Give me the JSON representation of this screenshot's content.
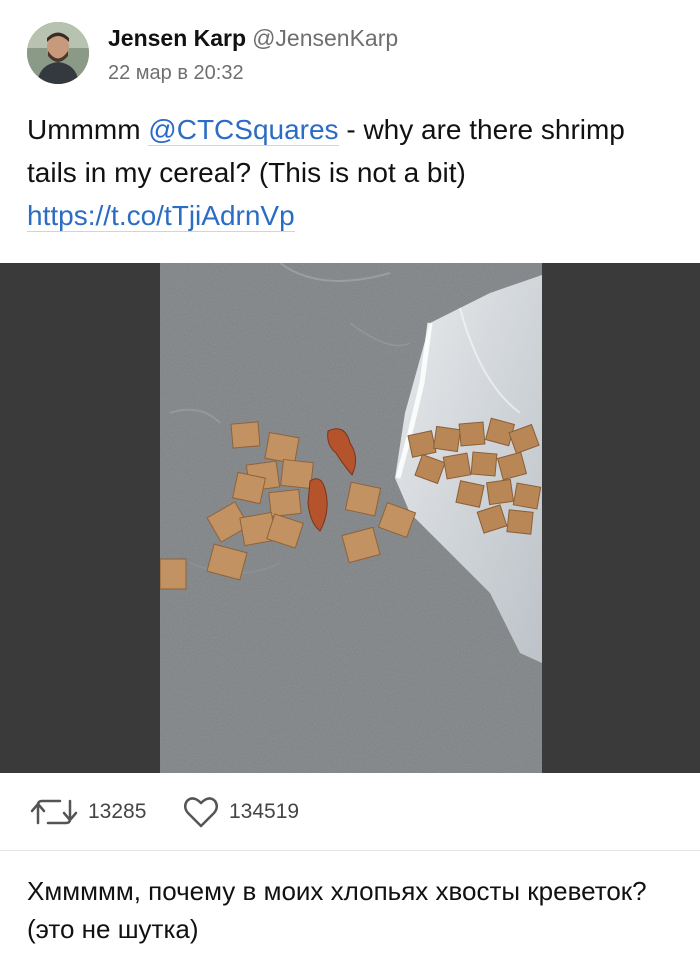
{
  "post": {
    "author_name": "Jensen Karp",
    "author_handle": "@JensenKarp",
    "timestamp": "22 мар в 20:32",
    "text_prefix": "Ummmm ",
    "mention": "@CTCSquares",
    "text_suffix": " - why are there shrimp tails in my cereal? (This is not a bit) ",
    "link": "https://t.co/tTjiAdrnVp"
  },
  "stats": {
    "retweet_count": "13285",
    "like_count": "134519",
    "retweet_icon": "retweet-icon",
    "like_icon": "heart-icon"
  },
  "translation": {
    "text": "Хммммм, почему в моих хлопьях хвосты креветок? (это не шутка)"
  },
  "colors": {
    "link": "#2b6cc4",
    "media_background": "#3a3a3a",
    "meta_text": "#6f6f6f"
  }
}
